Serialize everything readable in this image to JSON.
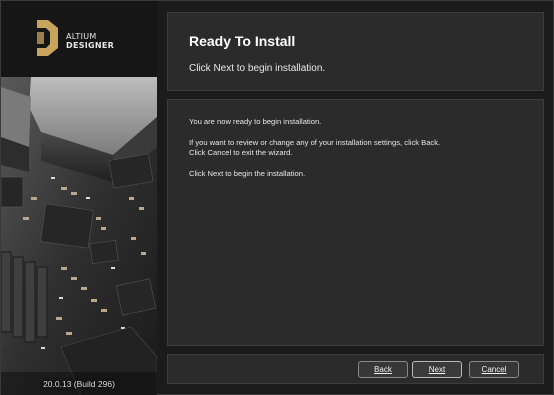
{
  "brand": {
    "name_line1": "ALTIUM",
    "name_line2": "DESIGNER",
    "version": "20.0.13 (Build 296)"
  },
  "header": {
    "title": "Ready To Install",
    "subtitle": "Click Next to begin installation."
  },
  "content": {
    "line1": "You are now ready to begin installation.",
    "line2": "If you want to review or change any of your installation settings, click Back.",
    "line3": "Click Cancel to exit the wizard.",
    "line4": "Click Next to begin the installation."
  },
  "buttons": {
    "back": "Back",
    "next": "Next",
    "cancel": "Cancel"
  },
  "colors": {
    "logo_gold": "#c9a45c",
    "panel_bg": "#2b2b2b",
    "window_bg": "#1b1b1b"
  }
}
